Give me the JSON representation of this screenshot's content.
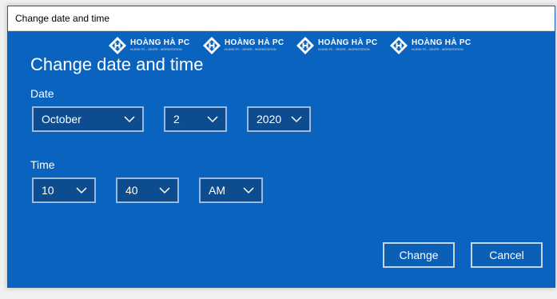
{
  "window": {
    "title": "Change date and time"
  },
  "watermark": {
    "brand": "HOÀNG HÀ PC",
    "tagline": "HI-END PC - SEVER - WORKSTATION",
    "logo_icon": "hh-diamond-logo",
    "repeat": 4
  },
  "dialog": {
    "heading": "Change date and time",
    "date_label": "Date",
    "time_label": "Time",
    "date": {
      "month": "October",
      "day": "2",
      "year": "2020"
    },
    "time": {
      "hour": "10",
      "minute": "40",
      "ampm": "AM"
    },
    "buttons": {
      "change": "Change",
      "cancel": "Cancel"
    }
  },
  "colors": {
    "background": "#0a63bf",
    "dropdown_fill": "#0c4c8f",
    "dropdown_border": "#9fb9d8",
    "text": "#ffffff"
  }
}
